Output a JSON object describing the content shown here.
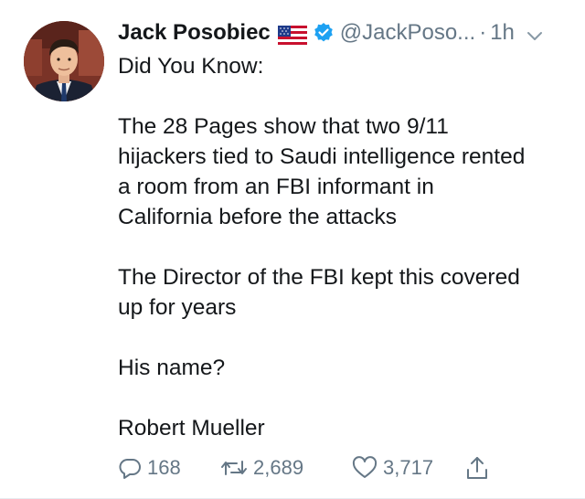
{
  "tweet": {
    "display_name": "Jack Posobiec",
    "flag_icon": "us-flag-icon",
    "verified_icon": "verified-badge-icon",
    "handle": "@JackPoso...",
    "separator": "·",
    "time": "1h",
    "menu_icon": "chevron-down-icon",
    "lines": [
      "Did You Know:",
      "",
      "The 28 Pages show that two 9/11",
      "hijackers tied to Saudi intelligence rented",
      "a room from an FBI informant in",
      "California before the attacks",
      "",
      "The Director of the FBI kept this covered",
      "up for years",
      "",
      "His name?",
      "",
      "Robert Mueller"
    ],
    "actions": {
      "reply_count": "168",
      "retweet_count": "2,689",
      "like_count": "3,717"
    }
  },
  "colors": {
    "text": "#14171a",
    "secondary": "#657786",
    "verified": "#1da1f2",
    "divider": "#e6ecf0"
  }
}
